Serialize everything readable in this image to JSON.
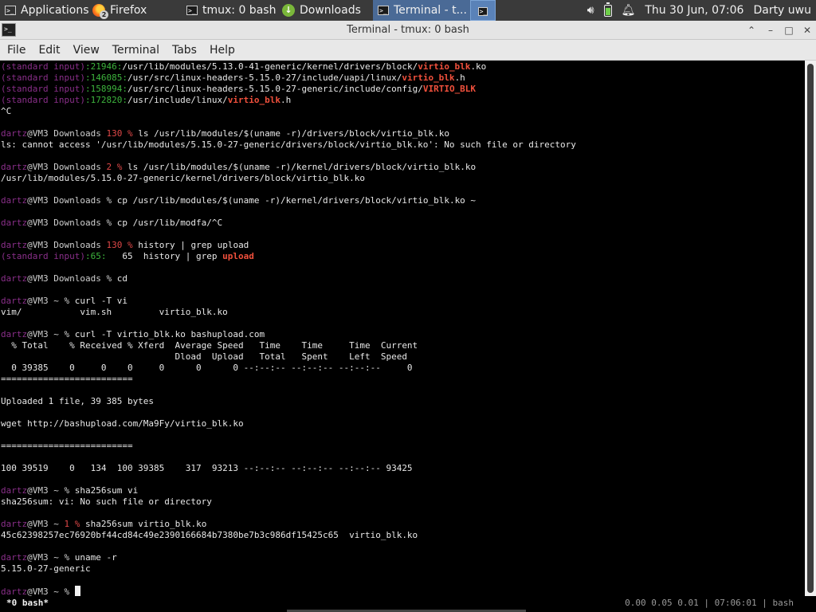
{
  "taskbar": {
    "applications": "Applications",
    "firefox": "Firefox",
    "firefox_badge": "2",
    "tmux": "tmux: 0 bash",
    "downloads": "Downloads",
    "terminal": "Terminal - t...",
    "clock": "Thu 30 Jun, 07:06",
    "user": "Darty uwu"
  },
  "window": {
    "title": "Terminal - tmux: 0 bash"
  },
  "menu": {
    "file": "File",
    "edit": "Edit",
    "view": "View",
    "terminal": "Terminal",
    "tabs": "Tabs",
    "help": "Help"
  },
  "prompt": {
    "user": "dartz",
    "host": "@VM3",
    "std": "(standard input)"
  },
  "lines": {
    "l0": {
      "n": ":21946:",
      "a": "/usr/lib/modules/5.13.0-41-generic/kernel/drivers/block/",
      "h": "virtio_blk",
      "b": ".ko"
    },
    "l1": {
      "n": ":146085:",
      "a": "/usr/src/linux-headers-5.15.0-27/include/uapi/linux/",
      "h": "virtio_blk",
      "b": ".h"
    },
    "l2": {
      "n": ":158994:",
      "a": "/usr/src/linux-headers-5.15.0-27-generic/include/config/",
      "h": "VIRTIO_BLK"
    },
    "l3": {
      "n": ":172820:",
      "a": "/usr/include/linux/",
      "h": "virtio_blk",
      "b": ".h"
    },
    "l4": "^C",
    "l5": {
      "dir": " Downloads ",
      "code": "130",
      "sym": " % ",
      "cmd": "ls /usr/lib/modules/$(uname -r)/drivers/block/virtio_blk.ko"
    },
    "l6": "ls: cannot access '/usr/lib/modules/5.15.0-27-generic/drivers/block/virtio_blk.ko': No such file or directory",
    "l7": {
      "dir": " Downloads ",
      "code": "2",
      "sym": " % ",
      "cmd": "ls /usr/lib/modules/$(uname -r)/kernel/drivers/block/virtio_blk.ko"
    },
    "l8": "/usr/lib/modules/5.15.0-27-generic/kernel/drivers/block/virtio_blk.ko",
    "l9": {
      "dir": " Downloads % ",
      "cmd": "cp /usr/lib/modules/$(uname -r)/kernel/drivers/block/virtio_blk.ko ~"
    },
    "l10": {
      "dir": " Downloads % ",
      "cmd": "cp /usr/lib/modfa/^C"
    },
    "l11": {
      "dir": " Downloads ",
      "code": "130",
      "sym": " % ",
      "cmd": "history | grep upload"
    },
    "l12": {
      "n": ":65:",
      "a": "   65  history | grep ",
      "h": "upload"
    },
    "l13": {
      "dir": " Downloads % ",
      "cmd": "cd"
    },
    "l14": {
      "dir": " ~ % ",
      "cmd": "curl -T vi"
    },
    "l15": "vim/           vim.sh         virtio_blk.ko",
    "l16": {
      "dir": " ~ % ",
      "cmd": "curl -T virtio_blk.ko bashupload.com"
    },
    "l17": "  % Total    % Received % Xferd  Average Speed   Time    Time     Time  Current",
    "l18": "                                 Dload  Upload   Total   Spent    Left  Speed",
    "l19": "  0 39385    0     0    0     0      0      0 --:--:-- --:--:-- --:--:--     0",
    "l20": "=========================",
    "l21": "Uploaded 1 file, 39 385 bytes",
    "l22": "wget http://bashupload.com/Ma9Fy/virtio_blk.ko",
    "l23": "=========================",
    "l24": "100 39519    0   134  100 39385    317  93213 --:--:-- --:--:-- --:--:-- 93425",
    "l25": {
      "dir": " ~ % ",
      "cmd": "sha256sum vi"
    },
    "l26": "sha256sum: vi: No such file or directory",
    "l27": {
      "dir": " ~ ",
      "code": "1",
      "sym": " % ",
      "cmd": "sha256sum virtio_blk.ko"
    },
    "l28": "45c62398257ec76920bf44cd84c49e2390166684b7380be7b3c986df15425c65  virtio_blk.ko",
    "l29": {
      "dir": " ~ % ",
      "cmd": "uname -r"
    },
    "l30": "5.15.0-27-generic",
    "l31": {
      "dir": " ~ % "
    }
  },
  "tmux": {
    "left": " *0 bash*",
    "right": "0.00 0.05 0.01 | 07:06:01 | bash"
  },
  "colors": {
    "std_magenta": "#8a2f8a",
    "line_green": "#3db43d",
    "error_red": "#e04848",
    "match_red": "#f0503c"
  }
}
